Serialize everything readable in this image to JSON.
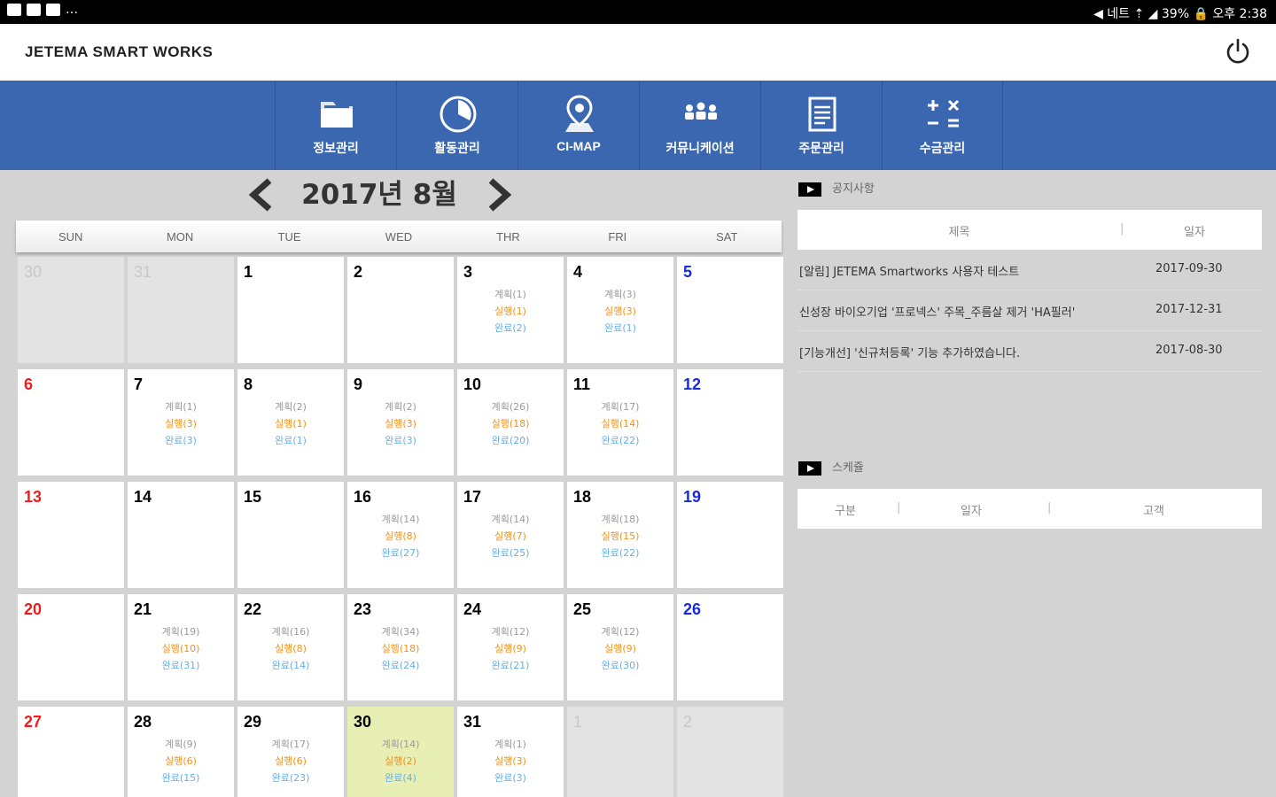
{
  "status_bar": {
    "right_text": "◀ 네트 ⇡ ◢ 39% 🔒 오후 2:38"
  },
  "app": {
    "title": "JETEMA SMART WORKS"
  },
  "nav": {
    "items": [
      {
        "label": "정보관리",
        "icon": "folder-icon"
      },
      {
        "label": "활동관리",
        "icon": "clock-icon"
      },
      {
        "label": "CI-MAP",
        "icon": "map-pin-icon"
      },
      {
        "label": "커뮤니케이션",
        "icon": "people-icon"
      },
      {
        "label": "주문관리",
        "icon": "clipboard-icon"
      },
      {
        "label": "수금관리",
        "icon": "calculator-icon"
      }
    ]
  },
  "calendar": {
    "month_title": "2017년 8월",
    "weekdays": [
      "SUN",
      "MON",
      "TUE",
      "WED",
      "THR",
      "FRI",
      "SAT"
    ],
    "weeks": [
      [
        {
          "day": "30",
          "muted": true
        },
        {
          "day": "31",
          "muted": true
        },
        {
          "day": "1"
        },
        {
          "day": "2"
        },
        {
          "day": "3",
          "plan": "계획(1)",
          "exec": "실행(1)",
          "visit": "완료(2)"
        },
        {
          "day": "4",
          "plan": "계획(3)",
          "exec": "실행(3)",
          "visit": "완료(1)"
        },
        {
          "day": "5"
        }
      ],
      [
        {
          "day": "6"
        },
        {
          "day": "7",
          "plan": "계획(1)",
          "exec": "실행(3)",
          "visit": "완료(3)"
        },
        {
          "day": "8",
          "plan": "계획(2)",
          "exec": "실행(1)",
          "visit": "완료(1)"
        },
        {
          "day": "9",
          "plan": "계획(2)",
          "exec": "실행(3)",
          "visit": "완료(3)"
        },
        {
          "day": "10",
          "plan": "계획(26)",
          "exec": "실행(18)",
          "visit": "완료(20)"
        },
        {
          "day": "11",
          "plan": "계획(17)",
          "exec": "실행(14)",
          "visit": "완료(22)"
        },
        {
          "day": "12"
        }
      ],
      [
        {
          "day": "13"
        },
        {
          "day": "14"
        },
        {
          "day": "15"
        },
        {
          "day": "16",
          "plan": "계획(14)",
          "exec": "실행(8)",
          "visit": "완료(27)"
        },
        {
          "day": "17",
          "plan": "계획(14)",
          "exec": "실행(7)",
          "visit": "완료(25)"
        },
        {
          "day": "18",
          "plan": "계획(18)",
          "exec": "실행(15)",
          "visit": "완료(22)"
        },
        {
          "day": "19"
        }
      ],
      [
        {
          "day": "20"
        },
        {
          "day": "21",
          "plan": "계획(19)",
          "exec": "실행(10)",
          "visit": "완료(31)"
        },
        {
          "day": "22",
          "plan": "계획(16)",
          "exec": "실행(8)",
          "visit": "완료(14)"
        },
        {
          "day": "23",
          "plan": "계획(34)",
          "exec": "실행(18)",
          "visit": "완료(24)"
        },
        {
          "day": "24",
          "plan": "계획(12)",
          "exec": "실행(9)",
          "visit": "완료(21)"
        },
        {
          "day": "25",
          "plan": "계획(12)",
          "exec": "실행(9)",
          "visit": "완료(30)"
        },
        {
          "day": "26"
        }
      ],
      [
        {
          "day": "27"
        },
        {
          "day": "28",
          "plan": "계획(9)",
          "exec": "실행(6)",
          "visit": "완료(15)"
        },
        {
          "day": "29",
          "plan": "계획(17)",
          "exec": "실행(6)",
          "visit": "완료(23)"
        },
        {
          "day": "30",
          "plan": "계획(14)",
          "exec": "실행(2)",
          "visit": "완료(4)",
          "today": true
        },
        {
          "day": "31",
          "plan": "계획(1)",
          "exec": "실행(3)",
          "visit": "완료(3)"
        },
        {
          "day": "1",
          "muted": true
        },
        {
          "day": "2",
          "muted": true
        }
      ]
    ]
  },
  "notices": {
    "section_title": "공지사항",
    "col_title": "제목",
    "col_date": "일자",
    "rows": [
      {
        "title": "[알림] JETEMA Smartworks 사용자 테스트",
        "date": "2017-09-30"
      },
      {
        "title": "신성장 바이오기업 '프로넥스' 주목_주름살 제거 'HA필러'",
        "date": "2017-12-31"
      },
      {
        "title": "[기능개선] '신규처등록' 기능 추가하였습니다.",
        "date": "2017-08-30"
      }
    ]
  },
  "schedule": {
    "section_title": "스케쥴",
    "col_type": "구분",
    "col_date": "일자",
    "col_customer": "고객"
  },
  "colors": {
    "nav_bg": "#3b67b0",
    "sunday": "#ee1c1c",
    "saturday": "#1a2bd8",
    "today_bg": "#e7efb4",
    "plan": "#9a9a9a",
    "exec": "#f0921c",
    "visit": "#6aaee4"
  }
}
